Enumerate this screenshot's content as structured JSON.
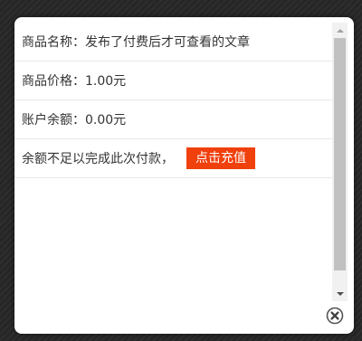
{
  "dialog": {
    "rows": [
      {
        "label": "商品名称：",
        "value": "发布了付费后才可查看的文章"
      },
      {
        "label": "商品价格：",
        "value": "1.00元"
      },
      {
        "label": "账户余额：",
        "value": "0.00元"
      }
    ],
    "insufficient_text": "余额不足以完成此次付款，",
    "recharge_label": "点击充值",
    "recharge_color": "#f0400c"
  },
  "icons": {
    "close": "close-icon",
    "scroll_up": "scroll-up-icon",
    "scroll_down": "scroll-down-icon"
  }
}
